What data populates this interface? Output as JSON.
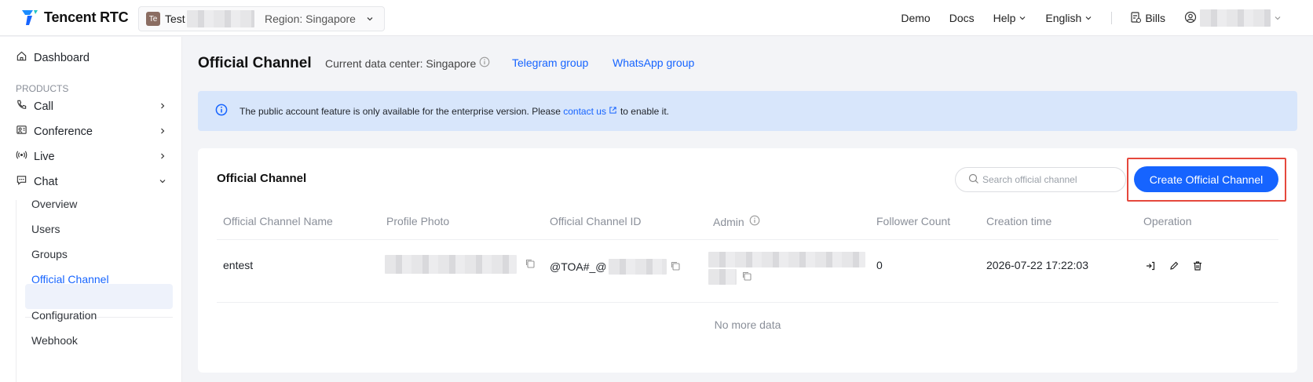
{
  "topbar": {
    "brand": "Tencent RTC",
    "app_badge": "Te",
    "app_name": "Test",
    "region": "Region: Singapore",
    "nav": [
      "Demo",
      "Docs",
      "Help",
      "English"
    ],
    "bills": "Bills"
  },
  "sidebar": {
    "dashboard": "Dashboard",
    "section": "PRODUCTS",
    "products": [
      "Call",
      "Conference",
      "Live",
      "Chat"
    ],
    "chat_items": [
      "Overview",
      "Users",
      "Groups",
      "Official Channel",
      "Configuration",
      "Webhook"
    ]
  },
  "main": {
    "title": "Official Channel",
    "data_center": "Current data center: Singapore",
    "telegram": "Telegram group",
    "whatsapp": "WhatsApp group",
    "notice_before": "The public account feature is only available for the enterprise version. Please",
    "notice_link": "contact us",
    "notice_after": "to enable it."
  },
  "card": {
    "title": "Official Channel",
    "search_placeholder": "Search official channel",
    "create_button": "Create Official Channel",
    "columns": [
      "Official Channel Name",
      "Profile Photo",
      "Official Channel ID",
      "Admin",
      "Follower Count",
      "Creation time",
      "Operation"
    ],
    "row": {
      "name": "entest",
      "channel_id": "@TOA#_@",
      "followers": "0",
      "created": "2026-07-22 17:22:03"
    },
    "no_more": "No more data"
  },
  "icons": [
    "logo-icon",
    "chevron-down-icon",
    "bills-icon",
    "user-icon",
    "home-icon",
    "phone-icon",
    "conference-icon",
    "live-icon",
    "chat-icon",
    "chevron-right-icon",
    "info-circle-icon",
    "external-link-icon",
    "search-icon",
    "copy-icon",
    "enter-icon",
    "edit-icon",
    "delete-icon"
  ],
  "colors": {
    "accent": "#1664ff",
    "notice_bg": "#d8e6fb",
    "highlight": "#e5483c"
  }
}
